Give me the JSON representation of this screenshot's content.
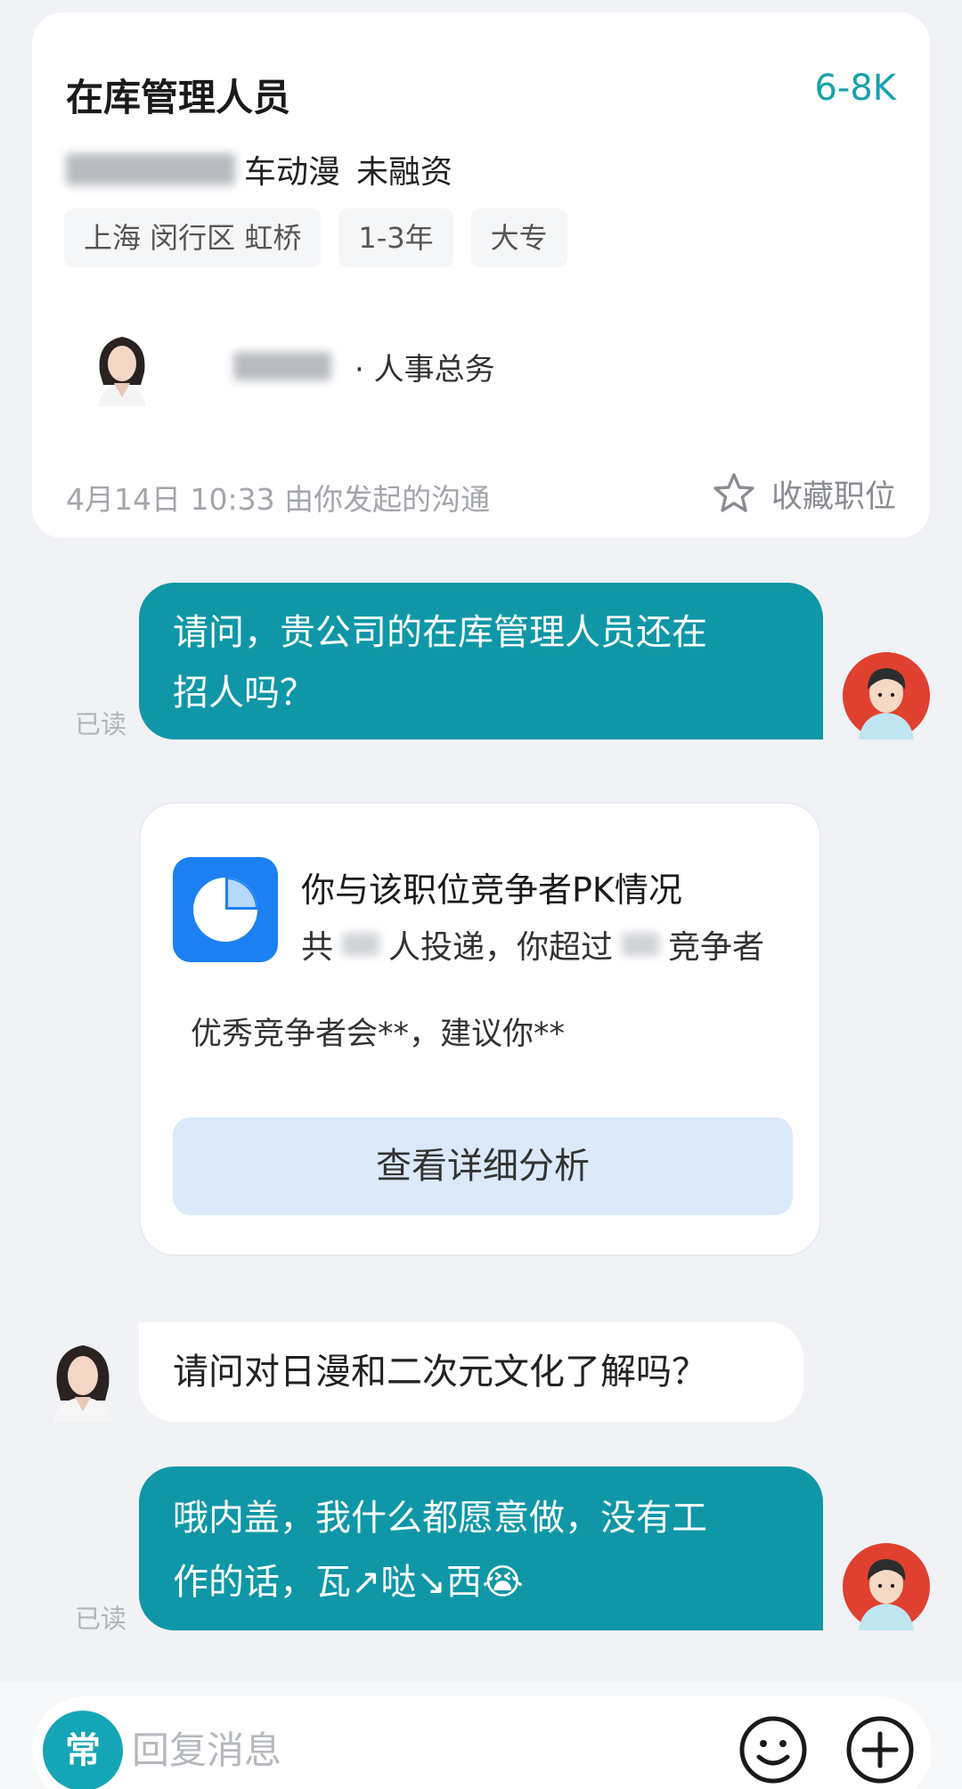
{
  "job_card": {
    "title": "在库管理人员",
    "salary": "6-8K",
    "company_tail": "车动漫",
    "funding": "未融资",
    "tags": [
      "上海 闵行区 虹桥",
      "1-3年",
      "大专"
    ],
    "recruiter_role": "· 人事总务",
    "started_text": "4月14日 10:33 由你发起的沟通",
    "favorite_label": "收藏职位"
  },
  "messages": {
    "msg1": {
      "line1": "请问，贵公司的在库管理人员还在",
      "line2": "招人吗？",
      "status": "已读"
    },
    "pk_card": {
      "title": "你与该职位竞争者PK情况",
      "desc_prefix": "共",
      "desc_middle": "人投递，你超过",
      "desc_suffix": "竞争者",
      "hint": "优秀竞争者会**，建议你**",
      "button": "查看详细分析"
    },
    "msg2": {
      "text": "请问对日漫和二次元文化了解吗？"
    },
    "msg3": {
      "line1": "哦内盖，我什么都愿意做，没有工",
      "line2": "作的话，瓦↗哒↘西",
      "emoji": "😭",
      "status": "已读"
    }
  },
  "input_bar": {
    "badge": "常",
    "placeholder": "回复消息"
  },
  "colors": {
    "accent": "#0f97a7",
    "salary": "#18a2ad",
    "pk_icon": "#1c80f2",
    "pk_button": "#dbe9f9"
  },
  "icons": {
    "favorite": "star-outline-icon",
    "pk": "pie-chart-icon",
    "emoji": "smiley-icon",
    "plus": "plus-circle-icon"
  }
}
